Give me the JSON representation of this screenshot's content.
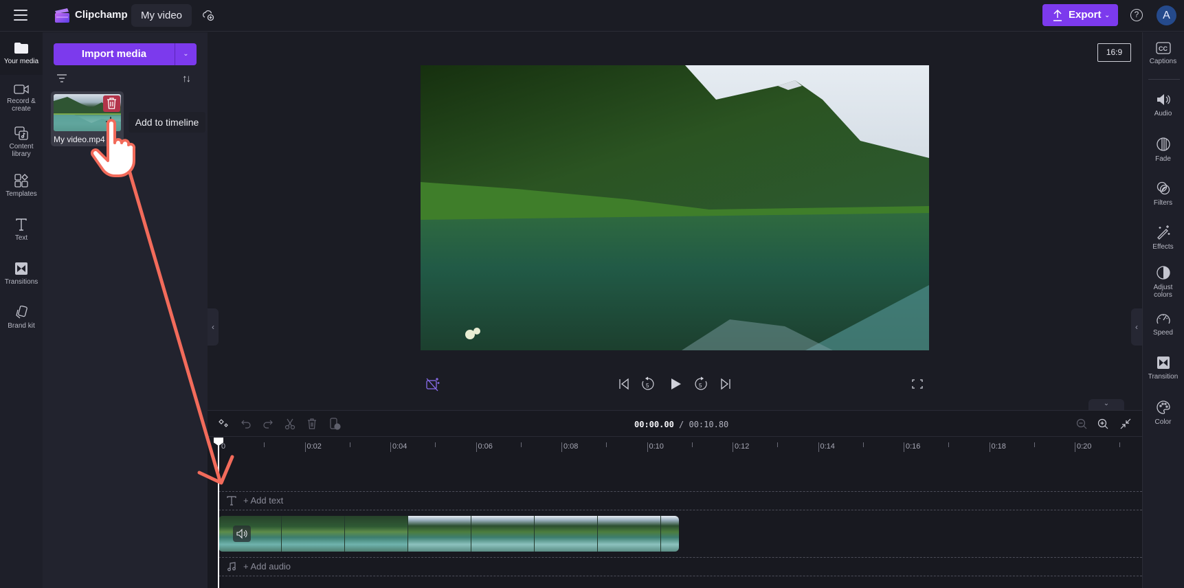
{
  "topbar": {
    "app_name": "Clipchamp",
    "project_title": "My video",
    "export_label": "Export",
    "help_label": "?",
    "avatar_initial": "A",
    "accent": "#7c3aed"
  },
  "left_rail": {
    "items": [
      {
        "label": "Your media",
        "icon": "folder-icon",
        "active": true
      },
      {
        "label": "Record &",
        "label2": "create",
        "icon": "camera-icon"
      },
      {
        "label": "Content",
        "label2": "library",
        "icon": "content-library-icon"
      },
      {
        "label": "Templates",
        "icon": "templates-icon"
      },
      {
        "label": "Text",
        "icon": "text-icon"
      },
      {
        "label": "Transitions",
        "icon": "transitions-icon"
      },
      {
        "label": "Brand kit",
        "icon": "brand-kit-icon"
      }
    ]
  },
  "media_panel": {
    "import_label": "Import media",
    "items": [
      {
        "filename": "My video.mp4"
      }
    ],
    "tooltip": "Add to timeline"
  },
  "preview": {
    "aspect_ratio": "16:9"
  },
  "right_rail": {
    "items": [
      {
        "label": "Captions",
        "icon": "captions-icon"
      },
      {
        "label": "Audio",
        "icon": "speaker-icon"
      },
      {
        "label": "Fade",
        "icon": "fade-icon"
      },
      {
        "label": "Filters",
        "icon": "filters-icon"
      },
      {
        "label": "Effects",
        "icon": "magic-wand-icon"
      },
      {
        "label": "Adjust",
        "label2": "colors",
        "icon": "adjust-colors-icon"
      },
      {
        "label": "Speed",
        "icon": "speedometer-icon"
      },
      {
        "label": "Transition",
        "icon": "transition-icon"
      },
      {
        "label": "Color",
        "icon": "palette-icon"
      }
    ]
  },
  "timeline": {
    "current_time": "00:00.00",
    "separator": " / ",
    "total_time": "00:10.80",
    "ruler_labels": [
      "0",
      "0:02",
      "0:04",
      "0:06",
      "0:08",
      "0:10",
      "0:12",
      "0:14",
      "0:16",
      "0:18",
      "0:20"
    ],
    "add_text_label": "+ Add text",
    "add_audio_label": "+ Add audio"
  }
}
